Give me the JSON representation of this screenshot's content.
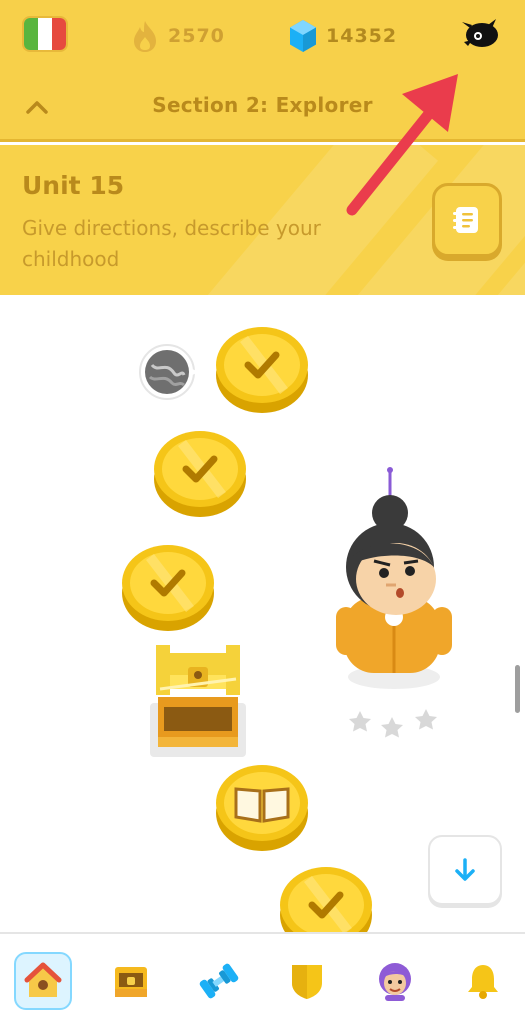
{
  "topbar": {
    "flag": "italian-flag",
    "streak": {
      "icon": "flame-icon",
      "count": "2570"
    },
    "gems": {
      "icon": "gem-icon",
      "count": "14352"
    },
    "profile": {
      "icon": "profile-avatar-icon"
    }
  },
  "section": {
    "title": "Section 2: Explorer",
    "collapse_icon": "chevron-up-icon"
  },
  "unit": {
    "title": "Unit 15",
    "description": "Give directions, describe your childhood",
    "guidebook_icon": "guidebook-icon"
  },
  "path": {
    "nodes": [
      {
        "type": "completed",
        "icon": "checkmark-icon"
      },
      {
        "type": "completed",
        "icon": "checkmark-icon"
      },
      {
        "type": "completed",
        "icon": "checkmark-icon"
      },
      {
        "type": "chest",
        "icon": "treasure-chest-icon"
      },
      {
        "type": "story",
        "icon": "book-icon"
      },
      {
        "type": "completed",
        "icon": "checkmark-icon"
      }
    ],
    "character": "duo-character-grandma",
    "character_stars": 3
  },
  "bottom_nav": [
    {
      "name": "learn",
      "icon": "home-icon",
      "active": true
    },
    {
      "name": "chest",
      "icon": "treasure-chest-icon",
      "active": false
    },
    {
      "name": "practice",
      "icon": "dumbbell-icon",
      "active": false
    },
    {
      "name": "leagues",
      "icon": "shield-icon",
      "active": false
    },
    {
      "name": "profile",
      "icon": "character-avatar-icon",
      "active": false
    },
    {
      "name": "notifications",
      "icon": "bell-icon",
      "active": false
    }
  ],
  "colors": {
    "header_yellow": "#f7d04a",
    "header_text": "#b98a1c",
    "coin_gold": "#f5c518",
    "annotation_red": "#ea3c4c",
    "nav_active_bg": "#ddf4ff",
    "nav_active_border": "#84d8ff"
  }
}
